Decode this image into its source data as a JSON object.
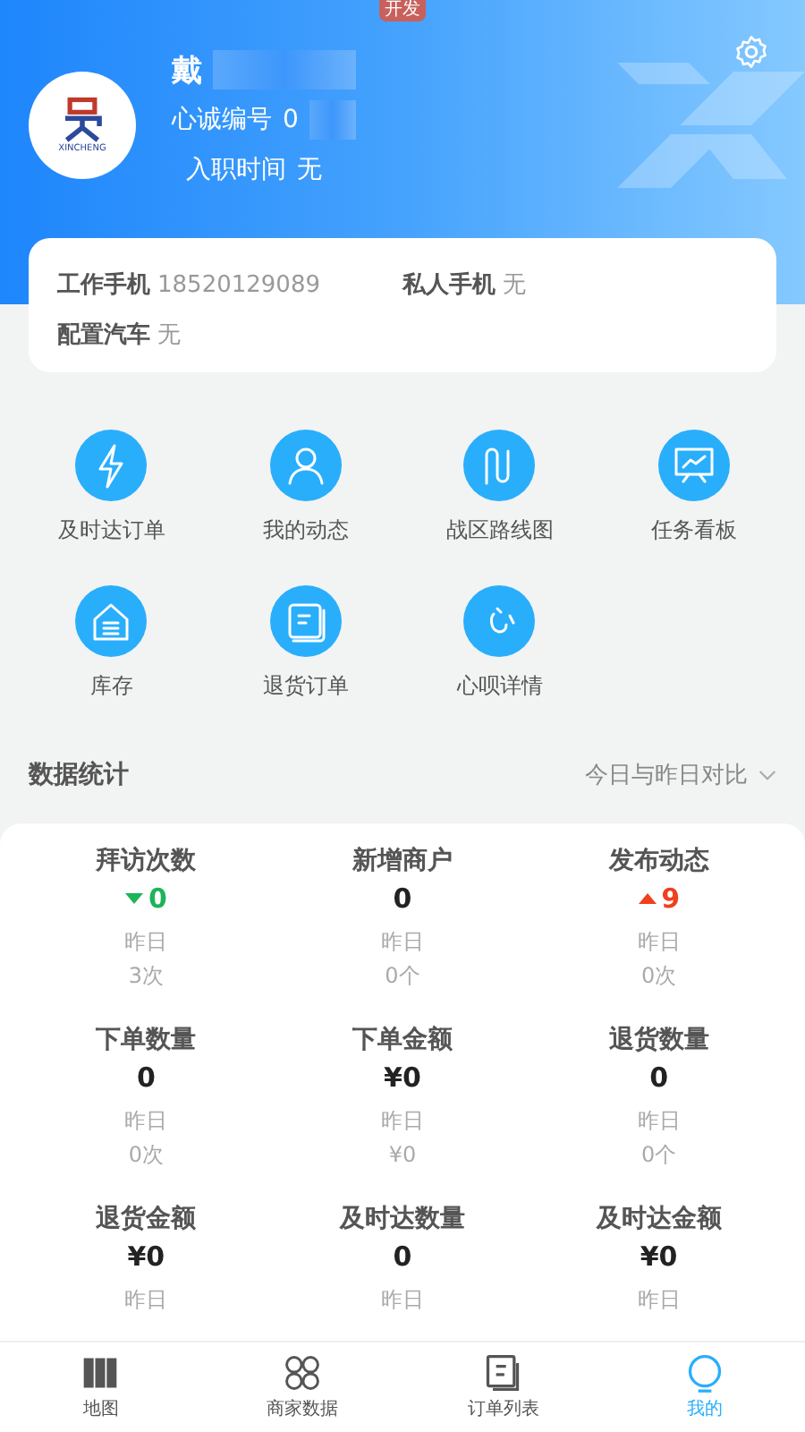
{
  "env_badge": "开发",
  "profile": {
    "name": "戴",
    "code_label": "心诚编号",
    "code_value": "0",
    "join_label": "入职时间",
    "join_value": "无",
    "logo_text": "XINCHENG"
  },
  "contact": [
    {
      "label": "工作手机",
      "value": "18520129089"
    },
    {
      "label": "私人手机",
      "value": "无"
    },
    {
      "label": "配置汽车",
      "value": "无"
    }
  ],
  "shortcuts": [
    {
      "label": "及时达订单"
    },
    {
      "label": "我的动态"
    },
    {
      "label": "战区路线图"
    },
    {
      "label": "任务看板"
    },
    {
      "label": "库存"
    },
    {
      "label": "退货订单"
    },
    {
      "label": "心呗详情"
    }
  ],
  "stats": {
    "title": "数据统计",
    "filter": "今日与昨日对比",
    "items": [
      {
        "label": "拜访次数",
        "value": "0",
        "kind": "down",
        "prev_label": "昨日",
        "prev_value": "3次"
      },
      {
        "label": "新增商户",
        "value": "0",
        "kind": "plain",
        "prev_label": "昨日",
        "prev_value": "0个"
      },
      {
        "label": "发布动态",
        "value": "9",
        "kind": "up",
        "prev_label": "昨日",
        "prev_value": "0次"
      },
      {
        "label": "下单数量",
        "value": "0",
        "kind": "plain",
        "prev_label": "昨日",
        "prev_value": "0次"
      },
      {
        "label": "下单金额",
        "value": "¥0",
        "kind": "plain",
        "prev_label": "昨日",
        "prev_value": "¥0"
      },
      {
        "label": "退货数量",
        "value": "0",
        "kind": "plain",
        "prev_label": "昨日",
        "prev_value": "0个"
      },
      {
        "label": "退货金额",
        "value": "¥0",
        "kind": "plain",
        "prev_label": "昨日"
      },
      {
        "label": "及时达数量",
        "value": "0",
        "kind": "plain",
        "prev_label": "昨日"
      },
      {
        "label": "及时达金额",
        "value": "¥0",
        "kind": "plain",
        "prev_label": "昨日"
      }
    ]
  },
  "tabbar": [
    {
      "label": "地图",
      "selected": false
    },
    {
      "label": "商家数据",
      "selected": false
    },
    {
      "label": "订单列表",
      "selected": false
    },
    {
      "label": "我的",
      "selected": true
    }
  ]
}
